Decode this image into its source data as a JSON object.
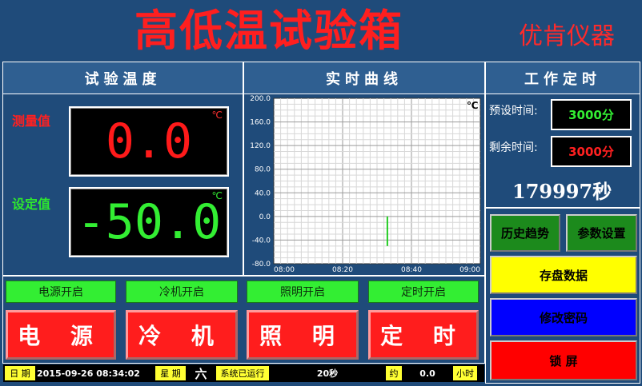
{
  "header": {
    "title": "高低温试验箱",
    "brand": "优肯仪器"
  },
  "sections": {
    "temp": "试验温度",
    "curve": "实时曲线",
    "timer": "工作定时"
  },
  "temp": {
    "measured_label": "测量值",
    "measured_value": "0.0",
    "set_label": "设定值",
    "set_value": "-50.0",
    "unit": "℃"
  },
  "status": [
    "电源开启",
    "冷机开启",
    "照明开启",
    "定时开启"
  ],
  "buttons": [
    "电 源",
    "冷 机",
    "照 明",
    "定 时"
  ],
  "timer": {
    "preset_label": "预设时间:",
    "preset_value": "3000分",
    "remain_label": "剩余时间:",
    "remain_value": "3000分",
    "seconds": "179997秒"
  },
  "right_buttons": {
    "history": "历史趋势",
    "params": "参数设置",
    "save": "存盘数据",
    "password": "修改密码",
    "lock": "锁 屏"
  },
  "footer": {
    "date_label": "日 期",
    "datetime": "2015-09-26   08:34:02",
    "week_label": "星 期",
    "week_value": "六",
    "running_label": "系统已运行",
    "running_value": "20秒",
    "approx_label": "约",
    "hours_value": "0.0",
    "hours_label": "小时"
  },
  "colors": {
    "background": "#1f4b7a",
    "red": "#ff1d1d",
    "green": "#33ee33",
    "yellow": "#ffff00",
    "blue": "#0000ff"
  },
  "chart_data": {
    "type": "line",
    "unit_label": "℃",
    "x_ticks": [
      "08:00",
      "08:20",
      "08:40",
      "09:00"
    ],
    "y_ticks": [
      "200.0",
      "160.0",
      "120.0",
      "80.0",
      "40.0",
      "0.0",
      "-40.0",
      "-80.0"
    ],
    "xlim": [
      "08:00",
      "09:00"
    ],
    "ylim": [
      -80,
      200
    ],
    "grid": true,
    "series": [
      {
        "color": "#22cc22",
        "points": [
          {
            "x": "08:33",
            "y": 0
          },
          {
            "x": "08:33",
            "y": -50
          }
        ]
      }
    ]
  }
}
